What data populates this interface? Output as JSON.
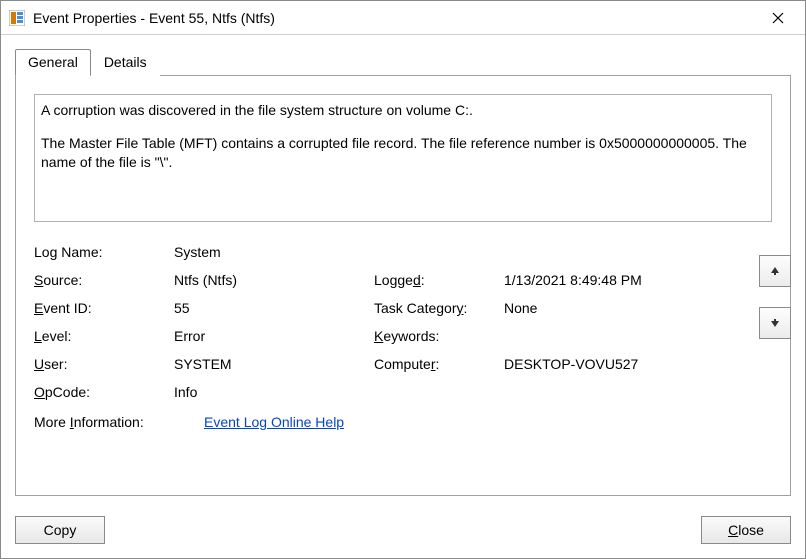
{
  "window": {
    "title": "Event Properties - Event 55, Ntfs (Ntfs)"
  },
  "tabs": {
    "general": "General",
    "details": "Details"
  },
  "description": {
    "p1": "A corruption was discovered in the file system structure on volume C:.",
    "p2": "The Master File Table (MFT) contains a corrupted file record.  The file reference number is 0x5000000000005.  The name of the file is \"\\\"."
  },
  "fields": {
    "logname_label_pre": "Lo",
    "logname_label_mn": "g",
    "logname_label_post": " Name:",
    "logname_value": "System",
    "source_label_mn": "S",
    "source_label_post": "ource:",
    "source_value": "Ntfs (Ntfs)",
    "logged_label": "Logge",
    "logged_label_mn": "d",
    "logged_label_post": ":",
    "logged_value": "1/13/2021 8:49:48 PM",
    "eventid_label_mn": "E",
    "eventid_label_post": "vent ID:",
    "eventid_value": "55",
    "taskcat_label": "Task Categor",
    "taskcat_label_mn": "y",
    "taskcat_label_post": ":",
    "taskcat_value": "None",
    "level_label_mn": "L",
    "level_label_post": "evel:",
    "level_value": "Error",
    "keywords_label_mn": "K",
    "keywords_label_post": "eywords:",
    "keywords_value": "",
    "user_label_mn": "U",
    "user_label_post": "ser:",
    "user_value": "SYSTEM",
    "computer_label": "Compute",
    "computer_label_mn": "r",
    "computer_label_post": ":",
    "computer_value": "DESKTOP-VOVU527",
    "opcode_label_mn": "O",
    "opcode_label_post": "pCode:",
    "opcode_value": "Info",
    "moreinfo_label_pre": "More ",
    "moreinfo_label_mn": "I",
    "moreinfo_label_post": "nformation:",
    "moreinfo_link": "Event Log Online Help"
  },
  "buttons": {
    "copy": "Copy",
    "close_pre": "",
    "close_mn": "C",
    "close_post": "lose"
  }
}
